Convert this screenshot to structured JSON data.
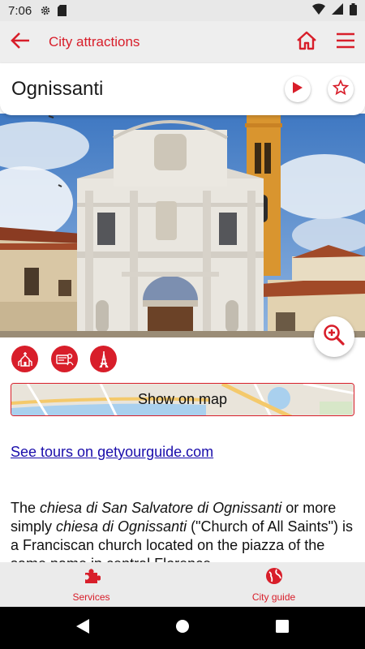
{
  "status_bar": {
    "time": "7:06",
    "icons": [
      "settings-icon",
      "sd-card-icon",
      "wifi-icon",
      "signal-icon",
      "battery-icon"
    ]
  },
  "app_bar": {
    "title": "City attractions",
    "icons": [
      "back-arrow-icon",
      "home-icon",
      "menu-icon"
    ]
  },
  "attraction": {
    "name": "Ognissanti",
    "icons": [
      "play-icon",
      "star-outline-icon"
    ]
  },
  "photo": {
    "subject": "church-facade"
  },
  "category_icons": [
    "church-icon",
    "museum-icon",
    "landmark-icon"
  ],
  "map_button": {
    "label": "Show on map"
  },
  "tours_link": {
    "text": "See tours on getyourguide.com"
  },
  "description": {
    "t1": "The ",
    "i1": "chiesa di San Salvatore di Ognissanti",
    "t2": " or more simply ",
    "i2": "chiesa di Ognissanti",
    "t3": " (\"Church of All Saints\") is a Franciscan church located on the piazza of the same name in central Florence"
  },
  "bottom_nav": {
    "items": [
      {
        "label": "Services",
        "icon": "puzzle-icon"
      },
      {
        "label": "City guide",
        "icon": "globe-icon"
      }
    ]
  },
  "system_nav": [
    "back-triangle-icon",
    "home-circle-icon",
    "recents-square-icon"
  ],
  "colors": {
    "accent": "#d81e2a",
    "link": "#1a0dab",
    "app_bar_bg": "#eeeeee",
    "status_bar_bg": "#e8e8e8",
    "bottom_nav_bg": "#ebebeb"
  }
}
